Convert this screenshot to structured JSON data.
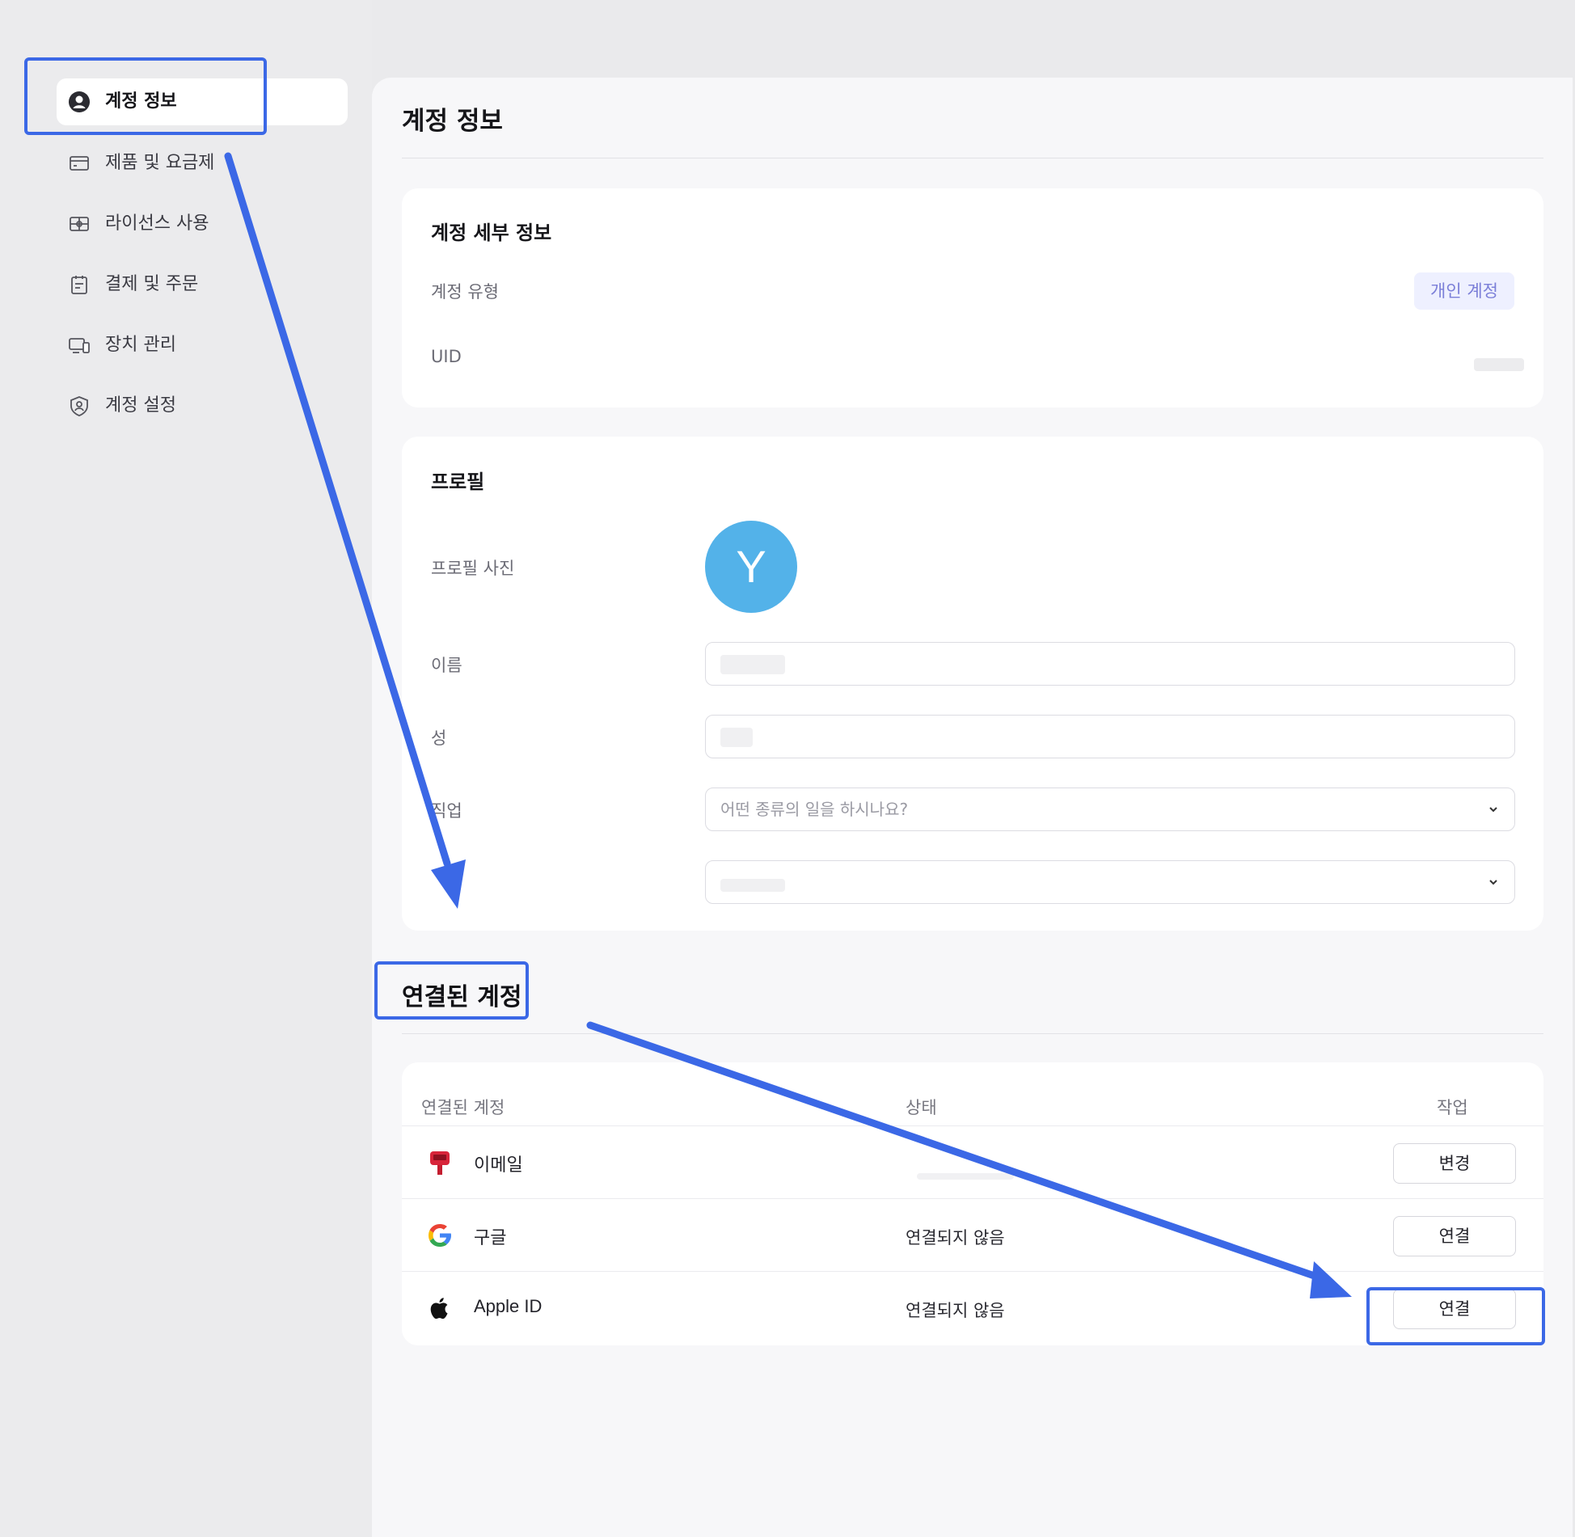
{
  "sidebar": {
    "items": [
      {
        "label": "계정 정보",
        "icon": "user-circle-icon",
        "active": true
      },
      {
        "label": "제품 및 요금제",
        "icon": "card-icon"
      },
      {
        "label": "라이선스 사용",
        "icon": "license-icon"
      },
      {
        "label": "결제 및 주문",
        "icon": "clipboard-icon"
      },
      {
        "label": "장치 관리",
        "icon": "devices-icon"
      },
      {
        "label": "계정 설정",
        "icon": "shield-user-icon"
      }
    ]
  },
  "main": {
    "title": "계정 정보",
    "account_details": {
      "title": "계정 세부 정보",
      "type_label": "계정 유형",
      "type_value": "개인 계정",
      "uid_label": "UID"
    },
    "profile": {
      "title": "프로필",
      "photo_label": "프로필 사진",
      "avatar_letter": "Y",
      "first_name_label": "이름",
      "last_name_label": "성",
      "job_label": "직업",
      "job_placeholder": "어떤 종류의 일을 하시나요?"
    },
    "linked_accounts": {
      "title": "연결된 계정",
      "columns": {
        "account": "연결된 계정",
        "status": "상태",
        "action": "작업"
      },
      "rows": [
        {
          "name": "이메일",
          "icon": "mailbox-icon",
          "status": "",
          "action": "변경"
        },
        {
          "name": "구글",
          "icon": "google-icon",
          "status": "연결되지 않음",
          "action": "연결"
        },
        {
          "name": "Apple ID",
          "icon": "apple-icon",
          "status": "연결되지 않음",
          "action": "연결"
        }
      ]
    }
  },
  "colors": {
    "accent": "#3b68e6",
    "avatar": "#53b2e9",
    "badge_bg": "#eef0ff",
    "badge_text": "#7b7fd8"
  }
}
